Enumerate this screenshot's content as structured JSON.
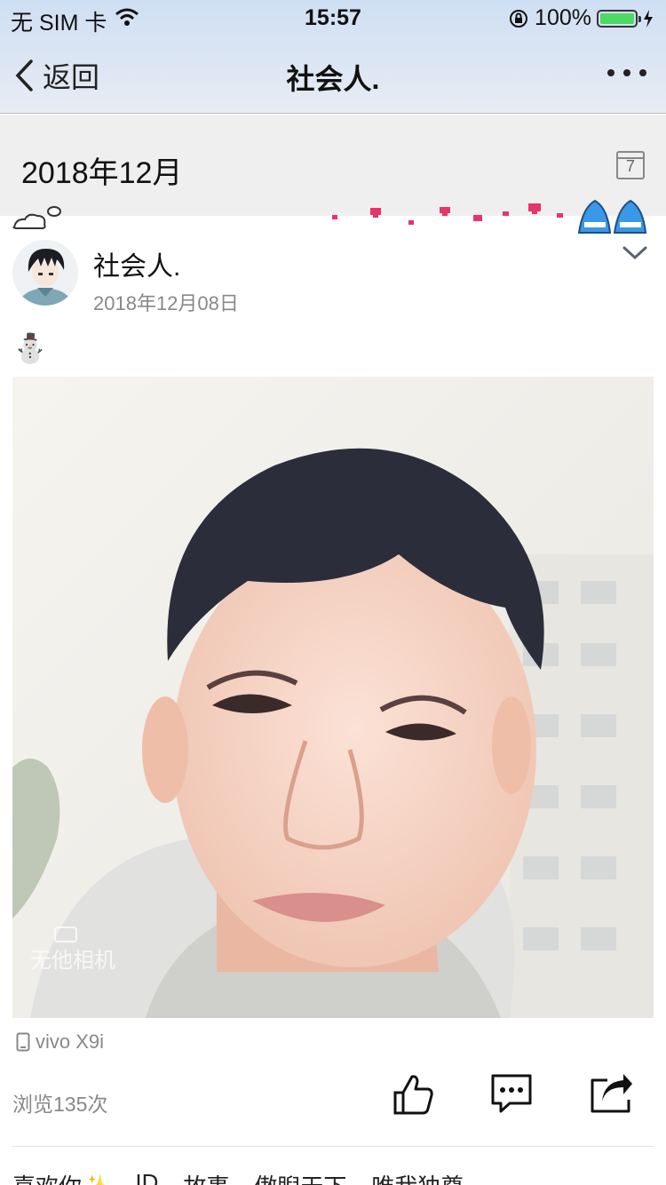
{
  "status_bar": {
    "carrier": "无 SIM 卡",
    "time": "15:57",
    "battery": "100%"
  },
  "nav": {
    "back_label": "返回",
    "title": "社会人."
  },
  "month_header": {
    "month": "2018年12月",
    "calendar_day": "7"
  },
  "post": {
    "author": "社会人.",
    "date": "2018年12月08日",
    "content_emoji": "⛄",
    "watermark": "无他相机",
    "device": "vivo   X9i",
    "views": "浏览135次"
  },
  "tags": [
    "喜欢你✨",
    "ID",
    "故事",
    "傲睨天下",
    "唯我独尊"
  ],
  "colors": {
    "accent_green": "#4cd964",
    "nav_gradient_top": "#cfdff3"
  }
}
